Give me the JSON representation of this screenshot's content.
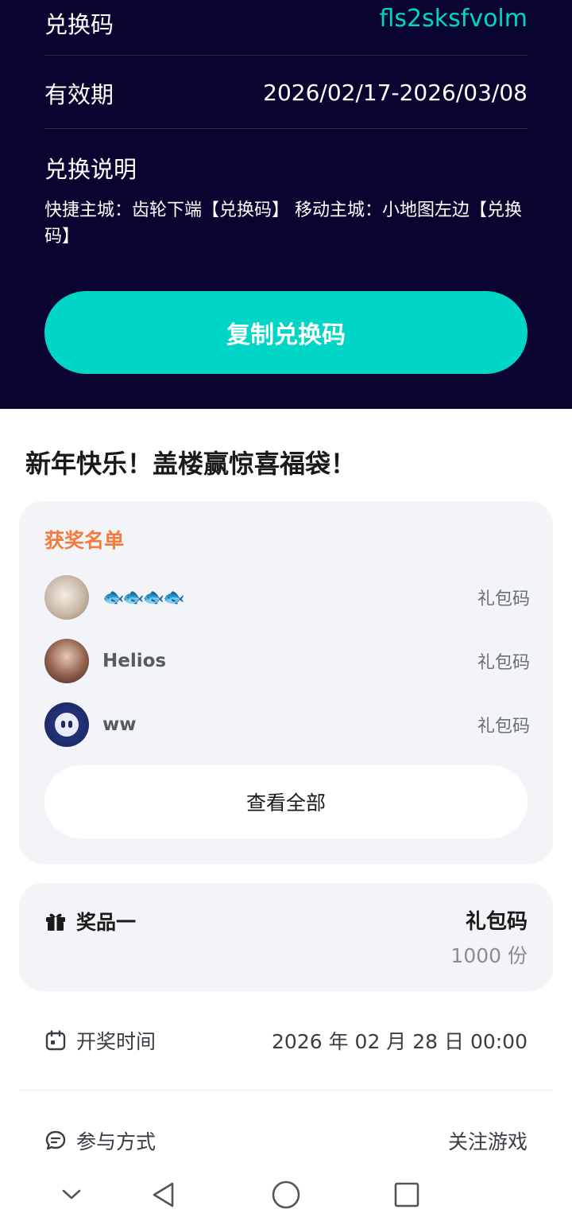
{
  "redeem": {
    "code_label": "兑换码",
    "code_value": "fls2sksfvolm",
    "valid_label": "有效期",
    "valid_value": "2026/02/17-2026/03/08",
    "explain_title": "兑换说明",
    "explain_text": "快捷主城：齿轮下端【兑换码】 移动主城：小地图左边【兑换码】",
    "copy_button": "复制兑换码"
  },
  "event": {
    "title": "新年快乐！盖楼赢惊喜福袋！",
    "winners": {
      "label": "获奖名单",
      "list": [
        {
          "name": "🐟🐟🐟🐟",
          "prize": "礼包码"
        },
        {
          "name": "Helios",
          "prize": "礼包码"
        },
        {
          "name": "ww",
          "prize": "礼包码"
        }
      ],
      "view_all": "查看全部"
    },
    "prize": {
      "name": "奖品一",
      "type": "礼包码",
      "count": "1000 份"
    },
    "draw_time": {
      "label": "开奖时间",
      "value": "2026 年 02 月 28 日 00:00"
    },
    "participation": {
      "label": "参与方式",
      "value": "关注游戏"
    }
  },
  "colors": {
    "panel_bg": "#0a0530",
    "accent": "#00d6c6",
    "winners_label": "#f47b3c",
    "card_bg": "#f3f4f7"
  },
  "icons": [
    "gift-icon",
    "calendar-icon",
    "chat-icon",
    "chevron-down-icon",
    "back-triangle-icon",
    "home-circle-icon",
    "recents-square-icon"
  ]
}
